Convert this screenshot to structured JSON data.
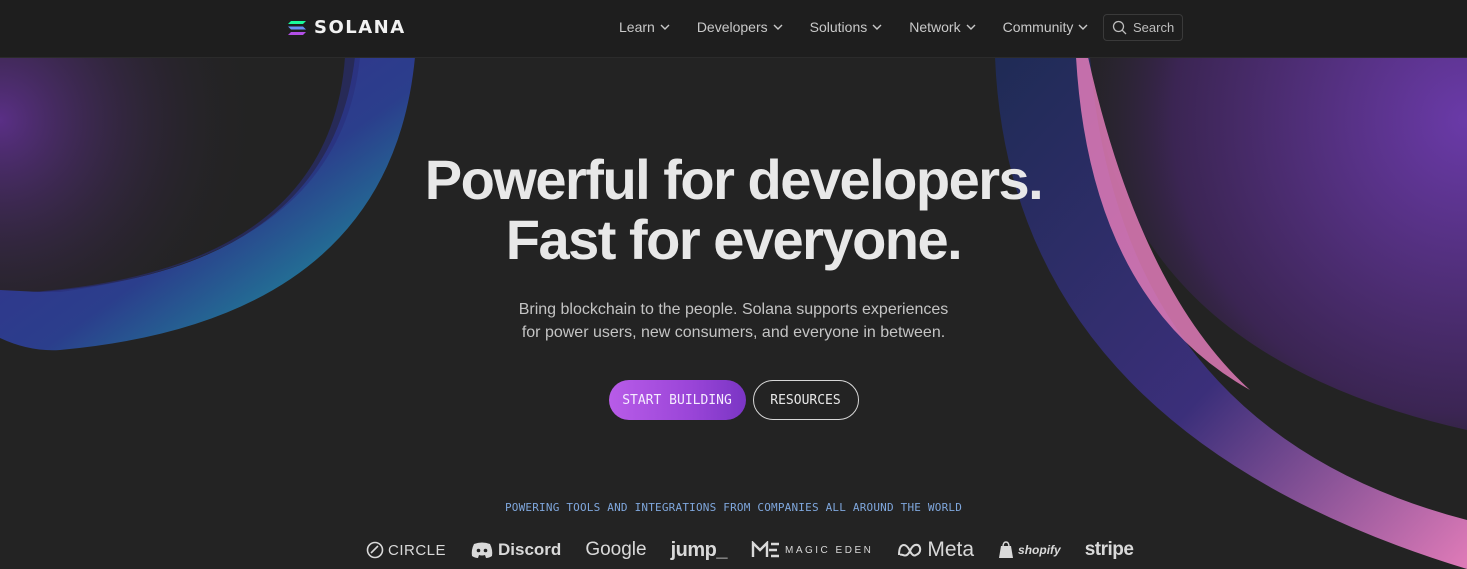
{
  "header": {
    "logo_text": "SOLANA",
    "nav": [
      {
        "label": "Learn"
      },
      {
        "label": "Developers"
      },
      {
        "label": "Solutions"
      },
      {
        "label": "Network"
      },
      {
        "label": "Community"
      }
    ],
    "search_label": "Search"
  },
  "hero": {
    "headline_line1": "Powerful for developers.",
    "headline_line2": "Fast for everyone.",
    "subtext_line1": "Bring blockchain to the people. Solana supports experiences",
    "subtext_line2": "for power users, new consumers, and everyone in between.",
    "primary_button": "START BUILDING",
    "secondary_button": "RESOURCES"
  },
  "partners": {
    "caption": "POWERING TOOLS AND INTEGRATIONS FROM COMPANIES ALL AROUND THE WORLD",
    "logos": [
      "CIRCLE",
      "Discord",
      "Google",
      "jump_",
      "MAGIC EDEN",
      "Meta",
      "shopify",
      "stripe"
    ]
  },
  "colors": {
    "background": "#232323",
    "primary_button": "#a64fe0",
    "caption": "#7fa7dd",
    "accent_teal": "#17b3a0",
    "accent_purple": "#6a3aa8",
    "accent_pink": "#e07bb8"
  },
  "icons": [
    "solana-logo-icon",
    "chevron-down-icon",
    "search-icon",
    "circle-logo-icon",
    "discord-logo-icon",
    "magic-eden-logo-icon",
    "meta-logo-icon",
    "shopify-bag-icon"
  ]
}
